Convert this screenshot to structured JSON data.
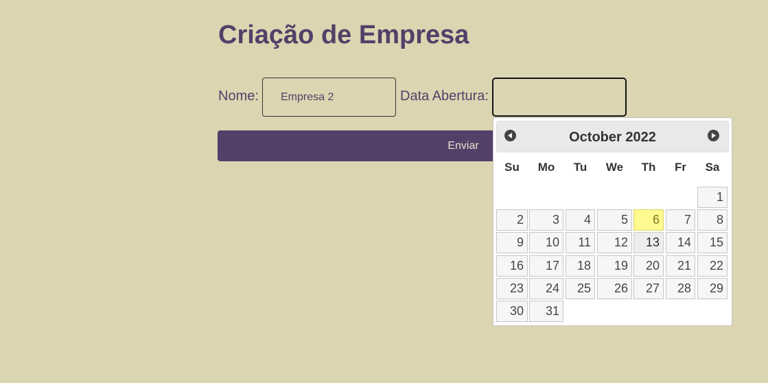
{
  "page": {
    "title": "Criação de Empresa"
  },
  "form": {
    "nome_label": "Nome:",
    "nome_value": "Empresa 2",
    "data_label": "Data Abertura:",
    "data_value": "",
    "submit_label": "Enviar"
  },
  "datepicker": {
    "title": "October 2022",
    "prev_icon": "circle-triangle-left-icon",
    "next_icon": "circle-triangle-right-icon",
    "weekdays": [
      "Su",
      "Mo",
      "Tu",
      "We",
      "Th",
      "Fr",
      "Sa"
    ],
    "days": [
      [
        "",
        "",
        "",
        "",
        "",
        "",
        "1"
      ],
      [
        "2",
        "3",
        "4",
        "5",
        "6",
        "7",
        "8"
      ],
      [
        "9",
        "10",
        "11",
        "12",
        "13",
        "14",
        "15"
      ],
      [
        "16",
        "17",
        "18",
        "19",
        "20",
        "21",
        "22"
      ],
      [
        "23",
        "24",
        "25",
        "26",
        "27",
        "28",
        "29"
      ],
      [
        "30",
        "31",
        "",
        "",
        "",
        "",
        ""
      ]
    ],
    "today": "6",
    "hovered": "13"
  },
  "colors": {
    "background": "#dbd5b1",
    "accent": "#543f69",
    "today_highlight": "#fffa90"
  }
}
